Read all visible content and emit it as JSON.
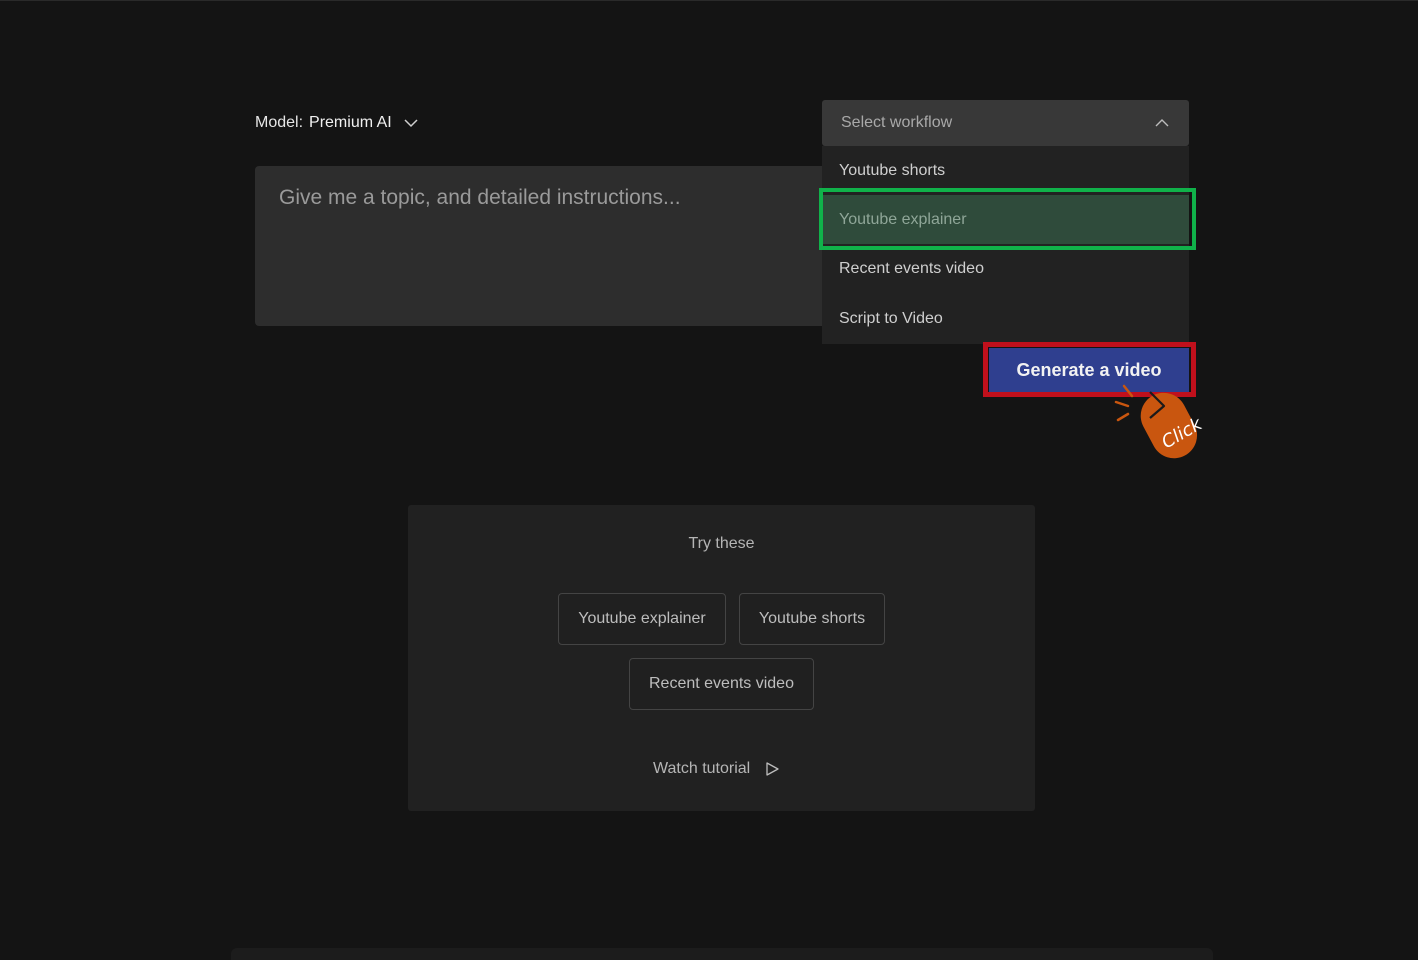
{
  "model": {
    "label": "Model:",
    "value": "Premium AI"
  },
  "prompt": {
    "placeholder": "Give me a topic, and detailed instructions..."
  },
  "workflow": {
    "placeholder": "Select workflow",
    "options": [
      {
        "label": "Youtube shorts"
      },
      {
        "label": "Youtube explainer",
        "selected": true
      },
      {
        "label": "Recent events video"
      },
      {
        "label": "Script to Video"
      }
    ]
  },
  "generate": {
    "label": "Generate a video"
  },
  "annotation": {
    "click_text": "Click",
    "highlight_selected_color": "#10b24a",
    "highlight_button_color": "#c0101c",
    "badge_color": "#c9560f"
  },
  "try_these": {
    "title": "Try these",
    "chips": [
      {
        "label": "Youtube explainer"
      },
      {
        "label": "Youtube shorts"
      },
      {
        "label": "Recent events video"
      }
    ],
    "tutorial_label": "Watch tutorial"
  },
  "colors": {
    "background": "#141414",
    "accent_button": "#2f3f8f",
    "selected_item": "#2f4b3b"
  },
  "icons": {
    "model_dropdown": "chevron-down-icon",
    "workflow_dropdown": "chevron-up-icon",
    "tutorial": "play-icon",
    "cursor": "cursor-arrow-icon"
  }
}
